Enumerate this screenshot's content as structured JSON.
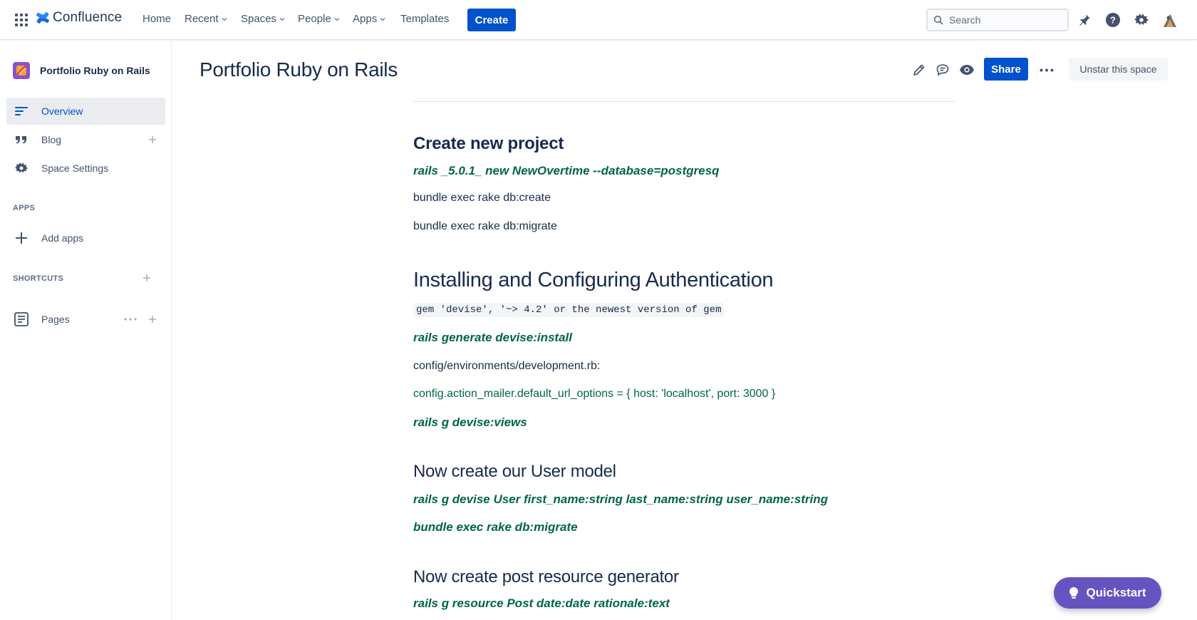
{
  "topnav": {
    "logo_text": "Confluence",
    "items": [
      {
        "label": "Home",
        "has_dropdown": false
      },
      {
        "label": "Recent",
        "has_dropdown": true
      },
      {
        "label": "Spaces",
        "has_dropdown": true
      },
      {
        "label": "People",
        "has_dropdown": true
      },
      {
        "label": "Apps",
        "has_dropdown": true
      },
      {
        "label": "Templates",
        "has_dropdown": false
      }
    ],
    "create_label": "Create",
    "search_placeholder": "Search",
    "icons": [
      "app-switcher-icon",
      "notifications-icon",
      "help-icon",
      "settings-icon",
      "user-avatar"
    ]
  },
  "sidebar": {
    "space_name": "Portfolio Ruby on Rails",
    "items": [
      {
        "label": "Overview",
        "icon": "overview-icon",
        "active": true
      },
      {
        "label": "Blog",
        "icon": "quote-icon",
        "active": false
      },
      {
        "label": "Space Settings",
        "icon": "gear-icon",
        "active": false
      }
    ],
    "apps_section": "APPS",
    "add_apps_label": "Add apps",
    "shortcuts_section": "SHORTCUTS",
    "pages_label": "Pages"
  },
  "page": {
    "title": "Portfolio Ruby on Rails",
    "share_label": "Share",
    "unstar_label": "Unstar this space"
  },
  "content": {
    "h_create": "Create new project",
    "cmd_new": "rails _5.0.1_ new NewOvertime --database=postgresq",
    "line_create": "bundle exec rake db:create",
    "line_migrate": "bundle exec rake db:migrate",
    "h_auth": "Installing and Configuring  Authentication",
    "code_gem": "gem 'devise', '~> 4.2' or the newest version of gem",
    "cmd_devise_install": "rails generate devise:install",
    "line_config_path": "config/environments/development.rb:",
    "line_mailer": "config.action_mailer.default_url_options = { host: 'localhost', port: 3000 }",
    "cmd_devise_views": "rails g devise:views",
    "h_user_model": "Now create our User model",
    "cmd_user_model": "rails g devise User first_name:string last_name:string user_name:string",
    "cmd_migrate": "bundle exec rake db:migrate",
    "h_post_resource": "Now create post resource generator",
    "cmd_post_resource": "rails g resource Post date:date rationale:text"
  },
  "quickstart_label": "Quickstart",
  "colors": {
    "brand_blue": "#0052cc",
    "text_dark": "#172b4d",
    "command_green": "#006644",
    "quickstart_purple": "#6554c0"
  }
}
